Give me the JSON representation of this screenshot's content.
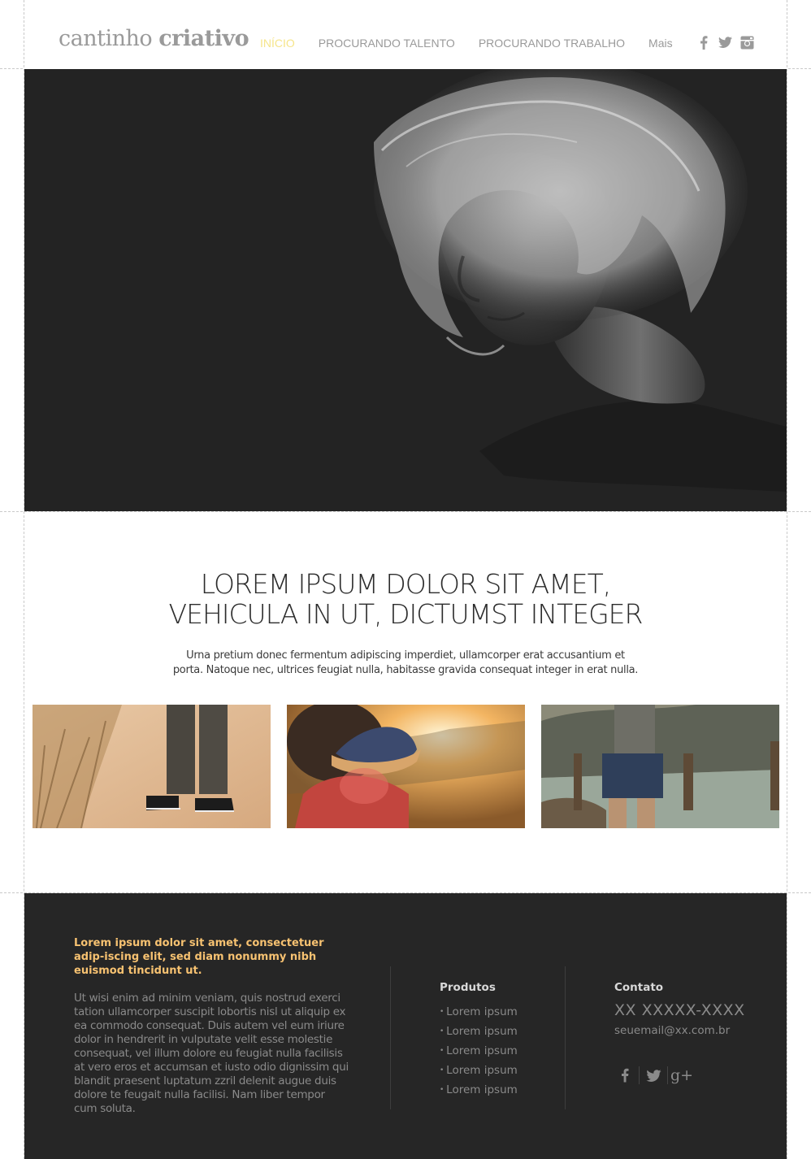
{
  "header": {
    "logo_light": "cantinho",
    "logo_bold": "criativo",
    "nav": [
      {
        "label": "INÍCIO",
        "active": true
      },
      {
        "label": "PROCURANDO TALENTO",
        "active": false
      },
      {
        "label": "PROCURANDO TRABALHO",
        "active": false
      },
      {
        "label": "Mais",
        "active": false
      }
    ],
    "social": {
      "facebook": "f",
      "twitter": "t",
      "instagram": "instagram-icon"
    }
  },
  "hero": {
    "image": "portrait-man-curly-hair-icon"
  },
  "main": {
    "headline_line1": "LOREM IPSUM DOLOR SIT AMET,",
    "headline_line2": "VEHICULA IN UT, DICTUMST INTEGER",
    "sub_line1": "Urna pretium donec fermentum adipiscing imperdiet, ullamcorper erat accusantium et",
    "sub_line2": "porta. Natoque nec, ultrices feugiat nulla, habitasse gravida consequat integer in erat nulla."
  },
  "footer": {
    "lead": "Lorem ipsum dolor sit amet, consectetuer adip-iscing elit, sed diam nonummy nibh euismod tincidunt ut.",
    "body": "Ut wisi enim ad minim veniam, quis nostrud exerci tation ullamcorper suscipit lobortis nisl ut aliquip ex ea commodo consequat. Duis autem vel eum iriure dolor in hendrerit in vulputate velit esse molestie consequat, vel illum dolore eu feugiat nulla facilisis at vero eros et accumsan et iusto odio dignissim qui blandit praesent luptatum zzril delenit augue duis dolore te feugait nulla facilisi. Nam liber tempor cum soluta.",
    "products_title": "Produtos",
    "products": [
      "Lorem ipsum",
      "Lorem ipsum",
      "Lorem ipsum",
      "Lorem ipsum",
      "Lorem ipsum"
    ],
    "contact_title": "Contato",
    "phone": "XX XXXXX-XXXX",
    "email": "seuemail@xx.com.br",
    "social": {
      "facebook": "f",
      "twitter": "t",
      "googleplus": "g+"
    }
  },
  "colors": {
    "accent_nav": "#f6e58a",
    "footer_lead": "#f7c271",
    "footer_bg": "#262626",
    "hero_bg": "#232323"
  }
}
